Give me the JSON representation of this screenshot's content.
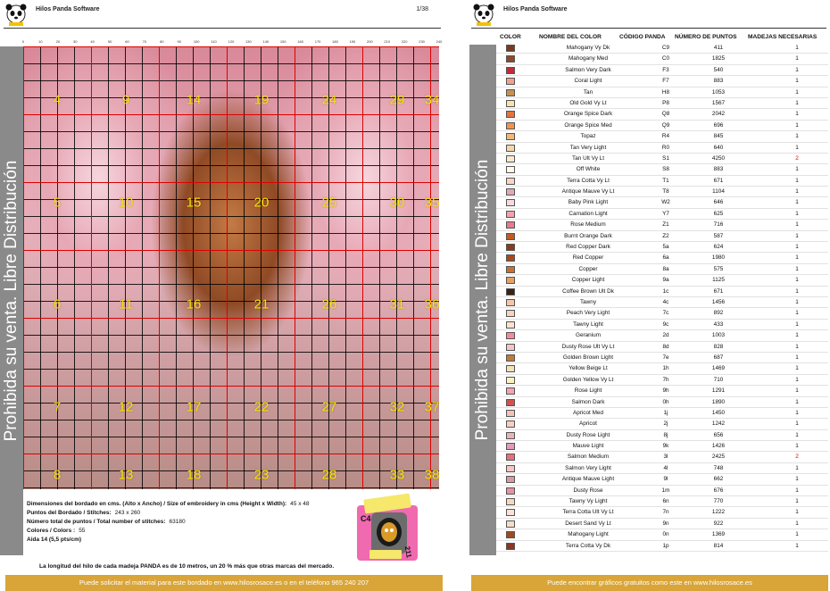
{
  "left_page": {
    "header": {
      "title": "Hilos Panda Software",
      "page": "1/38"
    },
    "vertical_text": "Prohibida su venta. Libre Distribución",
    "ruler": [
      "0",
      "10",
      "20",
      "30",
      "40",
      "50",
      "60",
      "70",
      "80",
      "90",
      "100",
      "110",
      "120",
      "130",
      "140",
      "150",
      "160",
      "170",
      "180",
      "190",
      "200",
      "210",
      "220",
      "230",
      "240"
    ],
    "segments": [
      [
        "4",
        "9",
        "14",
        "19",
        "24",
        "29",
        "34"
      ],
      [
        "5",
        "10",
        "15",
        "20",
        "25",
        "30",
        "35"
      ],
      [
        "6",
        "11",
        "16",
        "21",
        "26",
        "31",
        "36"
      ],
      [
        "7",
        "12",
        "17",
        "22",
        "27",
        "32",
        "37"
      ],
      [
        "8",
        "13",
        "18",
        "23",
        "28",
        "33",
        "38"
      ]
    ],
    "info": [
      {
        "label": "Dimensiones del bordado en cms. (Alto x Ancho) / Size of embroidery in cms (Height x Width):",
        "value": "45 x 48"
      },
      {
        "label": "Puntos del Bordado / Stitches:",
        "value": "243 x 260"
      },
      {
        "label": "Número total de puntos / Total number of stitches:",
        "value": "63180"
      },
      {
        "label": "Colores / Colors :",
        "value": "55"
      },
      {
        "label": "Aida 14 (5,5 pts/cm)",
        "value": ""
      }
    ],
    "note": "La longitud del hilo de cada madeja PANDA es de 10 metros, un 20 % más que otras marcas del mercado.",
    "footer": "Puede solicitar el material para este bordado en  www.hilosrosace.es o en el teléfono 965 240 207",
    "package": {
      "code": "C4",
      "number": "211",
      "tag_top": "CABLILLO GENÉRICO OTHERS SELLERS",
      "tag_bottom": "CANDLE COLOR"
    }
  },
  "right_page": {
    "header": {
      "title": "Hilos Panda Software"
    },
    "vertical_text": "Prohibida su venta. Libre Distribución",
    "columns": [
      "COLOR",
      "NOMBRE DEL COLOR",
      "CÓDIGO PANDA",
      "NÚMERO DE PUNTOS",
      "MADEJAS NECESARIAS"
    ],
    "rows": [
      {
        "color": "#7a3a1e",
        "name": "Mahogany Vy Dk",
        "code": "C9",
        "points": "411",
        "skeins": "1"
      },
      {
        "color": "#8b4a2c",
        "name": "Mahogany Med",
        "code": "C0",
        "points": "1825",
        "skeins": "1"
      },
      {
        "color": "#c42a3a",
        "name": "Salmon Very Dark",
        "code": "F3",
        "points": "540",
        "skeins": "1"
      },
      {
        "color": "#f2a08a",
        "name": "Coral Light",
        "code": "F7",
        "points": "883",
        "skeins": "1"
      },
      {
        "color": "#c8914f",
        "name": "Tan",
        "code": "H8",
        "points": "1053",
        "skeins": "1"
      },
      {
        "color": "#f7e2a8",
        "name": "Old Gold Vy Lt",
        "code": "P8",
        "points": "1567",
        "skeins": "1"
      },
      {
        "color": "#e6733a",
        "name": "Orange Spice Dark",
        "code": "Q8",
        "points": "2042",
        "skeins": "1"
      },
      {
        "color": "#f0934f",
        "name": "Orange Spice Med",
        "code": "Q9",
        "points": "696",
        "skeins": "1"
      },
      {
        "color": "#f2b876",
        "name": "Topaz",
        "code": "R4",
        "points": "845",
        "skeins": "1"
      },
      {
        "color": "#f7d6a8",
        "name": "Tan Very Light",
        "code": "R0",
        "points": "640",
        "skeins": "1"
      },
      {
        "color": "#fbe8cf",
        "name": "Tan Ult Vy Lt",
        "code": "S1",
        "points": "4250",
        "skeins": "2"
      },
      {
        "color": "#fff8ee",
        "name": "Off White",
        "code": "S8",
        "points": "883",
        "skeins": "1"
      },
      {
        "color": "#f6d6c2",
        "name": "Terra Cotta Vy Lt",
        "code": "T1",
        "points": "671",
        "skeins": "1"
      },
      {
        "color": "#e2a8b2",
        "name": "Antique Mauve Vy Lt",
        "code": "T8",
        "points": "1104",
        "skeins": "1"
      },
      {
        "color": "#fbd8de",
        "name": "Baby Pink Light",
        "code": "W2",
        "points": "646",
        "skeins": "1"
      },
      {
        "color": "#f5a0ae",
        "name": "Carnation Light",
        "code": "Y7",
        "points": "625",
        "skeins": "1"
      },
      {
        "color": "#e87a8e",
        "name": "Rose Medium",
        "code": "Z1",
        "points": "716",
        "skeins": "1"
      },
      {
        "color": "#c25a1c",
        "name": "Burnt Orange Dark",
        "code": "Z2",
        "points": "587",
        "skeins": "1"
      },
      {
        "color": "#8e3a1a",
        "name": "Red Copper Dark",
        "code": "5a",
        "points": "624",
        "skeins": "1"
      },
      {
        "color": "#a8481f",
        "name": "Red Copper",
        "code": "6a",
        "points": "1980",
        "skeins": "1"
      },
      {
        "color": "#c8702e",
        "name": "Copper",
        "code": "8a",
        "points": "575",
        "skeins": "1"
      },
      {
        "color": "#e8a060",
        "name": "Copper Light",
        "code": "9a",
        "points": "1125",
        "skeins": "1"
      },
      {
        "color": "#3a2212",
        "name": "Coffee Brown Ult Dk",
        "code": "1c",
        "points": "671",
        "skeins": "1"
      },
      {
        "color": "#f6c6a6",
        "name": "Tawny",
        "code": "4c",
        "points": "1456",
        "skeins": "1"
      },
      {
        "color": "#fbd2bc",
        "name": "Peach Very Light",
        "code": "7c",
        "points": "892",
        "skeins": "1"
      },
      {
        "color": "#fde2cc",
        "name": "Tawny Light",
        "code": "9c",
        "points": "433",
        "skeins": "1"
      },
      {
        "color": "#f48aa0",
        "name": "Geranium",
        "code": "2d",
        "points": "1003",
        "skeins": "1"
      },
      {
        "color": "#f3c6c6",
        "name": "Dusty Rose Ult Vy Lt",
        "code": "8d",
        "points": "828",
        "skeins": "1"
      },
      {
        "color": "#c07a3a",
        "name": "Golden Brown Light",
        "code": "7e",
        "points": "687",
        "skeins": "1"
      },
      {
        "color": "#f6e0b8",
        "name": "Yellow Beige Lt",
        "code": "1h",
        "points": "1469",
        "skeins": "1"
      },
      {
        "color": "#fbf2c2",
        "name": "Golden Yellow Vy Lt",
        "code": "7h",
        "points": "710",
        "skeins": "1"
      },
      {
        "color": "#f4a2b0",
        "name": "Rose Light",
        "code": "9h",
        "points": "1291",
        "skeins": "1"
      },
      {
        "color": "#d6504e",
        "name": "Salmon Dark",
        "code": "0h",
        "points": "1890",
        "skeins": "1"
      },
      {
        "color": "#f2c2b8",
        "name": "Apricot Med",
        "code": "1j",
        "points": "1450",
        "skeins": "1"
      },
      {
        "color": "#f6cfc2",
        "name": "Apricot",
        "code": "2j",
        "points": "1242",
        "skeins": "1"
      },
      {
        "color": "#eab2b6",
        "name": "Dusty Rose Light",
        "code": "8j",
        "points": "656",
        "skeins": "1"
      },
      {
        "color": "#e39ab8",
        "name": "Mauve Light",
        "code": "9k",
        "points": "1426",
        "skeins": "1"
      },
      {
        "color": "#e8707a",
        "name": "Salmon Medium",
        "code": "3l",
        "points": "2425",
        "skeins": "2"
      },
      {
        "color": "#f7c6c2",
        "name": "Salmon Very Light",
        "code": "4l",
        "points": "748",
        "skeins": "1"
      },
      {
        "color": "#d89aa4",
        "name": "Antique Mauve Light",
        "code": "9l",
        "points": "662",
        "skeins": "1"
      },
      {
        "color": "#e890a4",
        "name": "Dusty Rose",
        "code": "1m",
        "points": "676",
        "skeins": "1"
      },
      {
        "color": "#f4d8b8",
        "name": "Tawny Vy Light",
        "code": "6n",
        "points": "770",
        "skeins": "1"
      },
      {
        "color": "#fbe2d6",
        "name": "Terra Cotta Ult Vy Lt",
        "code": "7n",
        "points": "1222",
        "skeins": "1"
      },
      {
        "color": "#f6dcc6",
        "name": "Desert Sand Vy Lt",
        "code": "9n",
        "points": "922",
        "skeins": "1"
      },
      {
        "color": "#a04a22",
        "name": "Mahogany Light",
        "code": "0n",
        "points": "1369",
        "skeins": "1"
      },
      {
        "color": "#8a3624",
        "name": "Terra Cotta Vy Dk",
        "code": "1p",
        "points": "814",
        "skeins": "1"
      }
    ],
    "footer": "Puede encontrar gráficos gratuitos como este en www.hilosrosace.es"
  }
}
